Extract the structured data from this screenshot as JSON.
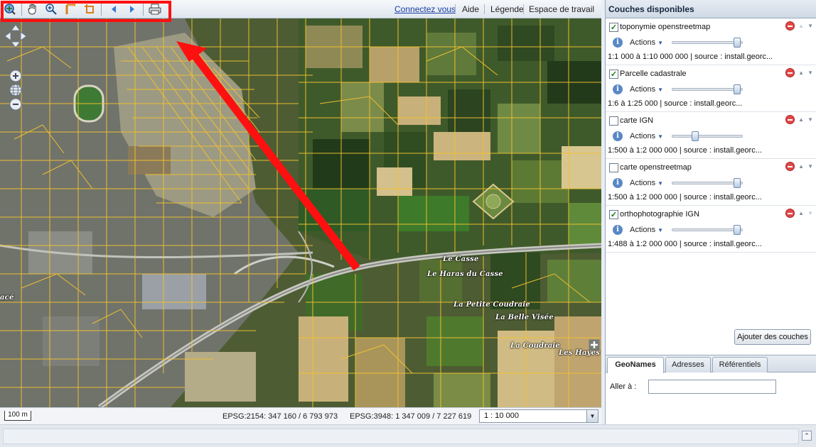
{
  "toolbar": {
    "tools": [
      "zoom-extent-icon",
      "pan-hand-icon",
      "zoom-in-icon",
      "measure-distance-icon",
      "measure-area-icon",
      "previous-view-icon",
      "next-view-icon",
      "print-icon"
    ],
    "links": {
      "connect": "Connectez vous",
      "help": "Aide",
      "legend": "Légende",
      "workspace": "Espace de travail",
      "workspace_caret": "▼"
    },
    "highlight_color": "#ff1010"
  },
  "map": {
    "place_labels": [
      "Le Casse",
      "Le Haras du Casse",
      "La Petite Coudraie",
      "La Belle Visée",
      "La Coudraie",
      "Les Hayes",
      "acé"
    ],
    "annotation_arrow_color": "#ff1010",
    "parcel_color": "#f2c230",
    "zoom_in": "+",
    "zoom_out": "−",
    "expand": "+"
  },
  "statusbar": {
    "scale_bar_label": "100 m",
    "epsg2154": "EPSG:2154: 347 160 / 6 793 973",
    "epsg3948": "EPSG:3948: 1 347 009 / 7 227 619",
    "scale_value": "1 : 10 000",
    "scale_arrow": "▼"
  },
  "layers_panel": {
    "title": "Couches disponibles",
    "actions_label": "Actions",
    "layers": [
      {
        "name": "toponymie openstreetmap",
        "checked": true,
        "info": "1:1 000 à 1:10 000 000 | source : install.georc...",
        "opacity": 0.95
      },
      {
        "name": "Parcelle cadastrale",
        "checked": true,
        "info": "1:6 à 1:25 000 | source : install.georc...",
        "opacity": 0.95
      },
      {
        "name": "carte IGN",
        "checked": false,
        "info": "1:500 à 1:2 000 000 | source : install.georc...",
        "opacity": 0.3
      },
      {
        "name": "carte openstreetmap",
        "checked": false,
        "info": "1:500 à 1:2 000 000 | source : install.georc...",
        "opacity": 0.95
      },
      {
        "name": "orthophotographie IGN",
        "checked": true,
        "info": "1:488 à 1:2 000 000 | source : install.georc...",
        "opacity": 0.95
      }
    ],
    "add_button": "Ajouter des couches"
  },
  "search_tabs": {
    "tabs": [
      "GeoNames",
      "Adresses",
      "Référentiels"
    ],
    "active": "GeoNames",
    "goto_label": "Aller à :",
    "goto_value": ""
  }
}
